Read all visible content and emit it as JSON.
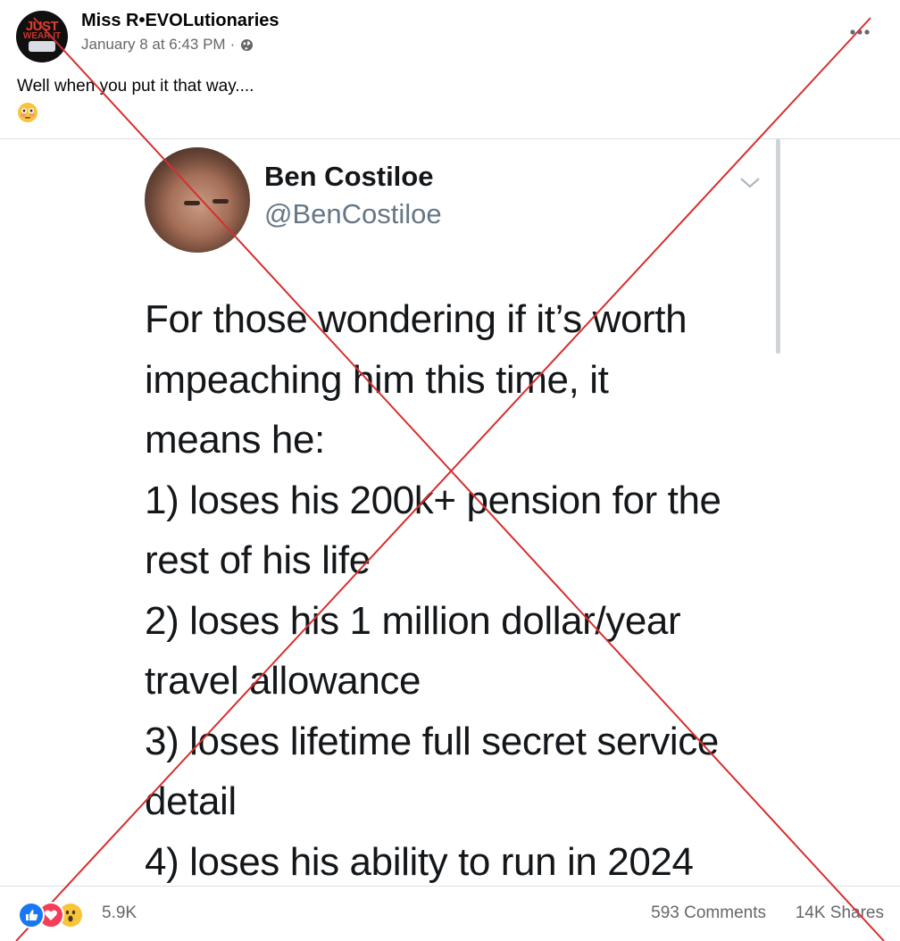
{
  "post": {
    "page_name": "Miss R•EVOLutionaries",
    "timestamp": "January 8 at 6:43 PM",
    "meta_separator": "·",
    "audience_icon": "globe-icon",
    "caption": "Well when you put it that way....",
    "caption_emoji": "flushed-face-emoji",
    "avatar_logo": {
      "line1": "JUST",
      "line2": "WEAR IT"
    }
  },
  "tweet": {
    "author": "Ben Costiloe",
    "handle": "@BenCostiloe",
    "lines": [
      "For those wondering if it’s worth",
      "impeaching him this time, it",
      "means he:",
      "1) loses his 200k+ pension for the",
      "rest of his life",
      "2) loses his 1 million dollar/year",
      "travel allowance",
      "3) loses lifetime full secret service",
      "detail",
      "4) loses his ability to run in 2024"
    ]
  },
  "footer": {
    "reaction_icons": [
      "like-icon",
      "love-icon",
      "wow-icon"
    ],
    "reaction_count": "5.9K",
    "comments": "593 Comments",
    "shares": "14K Shares"
  },
  "overlay": {
    "type": "red-x-cross",
    "color": "#d62f2f"
  }
}
